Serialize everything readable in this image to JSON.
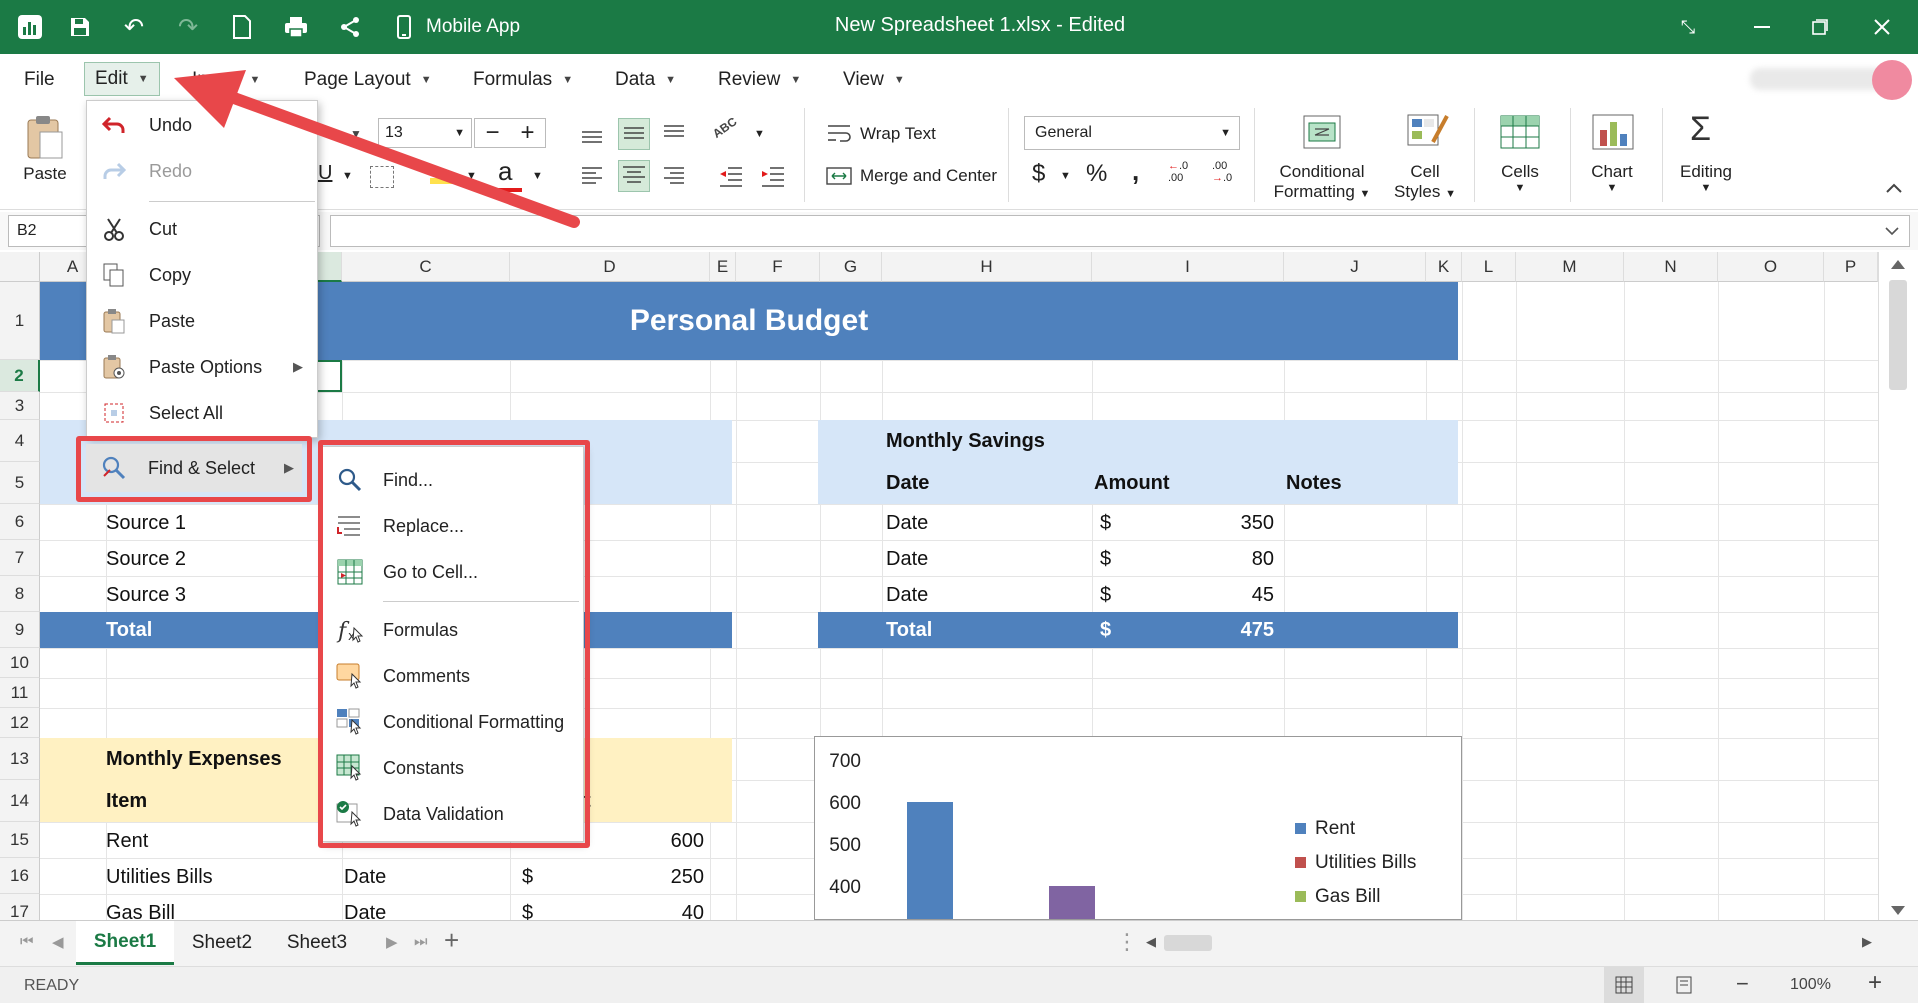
{
  "app": {
    "title": "New Spreadsheet 1.xlsx - Edited",
    "mobile_label": "Mobile App",
    "accent": "#1b7a45"
  },
  "menu": {
    "file": "File",
    "edit": "Edit",
    "insert": "Insert",
    "page_layout": "Page Layout",
    "formulas": "Formulas",
    "data": "Data",
    "review": "Review",
    "view": "View"
  },
  "ribbon": {
    "paste": "Paste",
    "font_size": "13",
    "wrap_text": "Wrap Text",
    "merge_center": "Merge and Center",
    "number_format": "General",
    "conditional_formatting_1": "Conditional",
    "conditional_formatting_2": "Formatting",
    "cell_styles_1": "Cell",
    "cell_styles_2": "Styles",
    "cells": "Cells",
    "chart": "Chart",
    "editing": "Editing",
    "currency": "$",
    "percent": "%",
    "comma": ","
  },
  "formula_bar": {
    "name_box": "B2",
    "formula": ""
  },
  "columns": [
    "A",
    "B",
    "C",
    "D",
    "E",
    "F",
    "G",
    "H",
    "I",
    "J",
    "K",
    "L",
    "M",
    "N",
    "O",
    "P"
  ],
  "rows": [
    "1",
    "2",
    "3",
    "4",
    "5",
    "6",
    "7",
    "8",
    "9",
    "10",
    "11",
    "12",
    "13",
    "14",
    "15",
    "16",
    "17"
  ],
  "sheet": {
    "title": "Personal Budget",
    "income_sources": [
      "Source 1",
      "Source 2",
      "Source 3"
    ],
    "income_total": "Total",
    "savings": {
      "title": "Monthly Savings",
      "headers": [
        "Date",
        "Amount",
        "Notes"
      ],
      "rows": [
        {
          "date": "Date",
          "cur": "$",
          "amount": "350"
        },
        {
          "date": "Date",
          "cur": "$",
          "amount": "80"
        },
        {
          "date": "Date",
          "cur": "$",
          "amount": "45"
        }
      ],
      "total": {
        "label": "Total",
        "cur": "$",
        "amount": "475"
      }
    },
    "expenses": {
      "title": "Monthly Expenses",
      "item_header": "Item",
      "trailing_header": "t",
      "rows": [
        {
          "item": "Rent",
          "date": "",
          "cur": "",
          "amount": "600"
        },
        {
          "item": "Utilities Bills",
          "date": "Date",
          "cur": "$",
          "amount": "250"
        },
        {
          "item": "Gas Bill",
          "date": "Date",
          "cur": "$",
          "amount": "40"
        }
      ]
    }
  },
  "chart_data": {
    "type": "bar",
    "y_ticks": [
      "700",
      "600",
      "500",
      "400"
    ],
    "ylim": [
      400,
      700
    ],
    "series": [
      {
        "name": "Rent",
        "value": 600,
        "color": "#4f81bd"
      },
      {
        "name": "Utilities Bills",
        "value": 400,
        "color": "#8064a2"
      }
    ],
    "legend": [
      {
        "name": "Rent",
        "color": "#4f81bd"
      },
      {
        "name": "Utilities Bills",
        "color": "#c0504d"
      },
      {
        "name": "Gas Bill",
        "color": "#9bbb59"
      }
    ],
    "legend_placement": "right"
  },
  "edit_menu": {
    "undo": "Undo",
    "redo": "Redo",
    "cut": "Cut",
    "copy": "Copy",
    "paste": "Paste",
    "paste_options": "Paste Options",
    "select_all": "Select All",
    "find_select": "Find & Select"
  },
  "find_menu": {
    "find": "Find...",
    "replace": "Replace...",
    "goto": "Go to Cell...",
    "formulas": "Formulas",
    "comments": "Comments",
    "conditional_formatting": "Conditional Formatting",
    "constants": "Constants",
    "data_validation": "Data Validation"
  },
  "tabs": [
    "Sheet1",
    "Sheet2",
    "Sheet3"
  ],
  "status": {
    "ready": "READY",
    "zoom": "100%"
  }
}
